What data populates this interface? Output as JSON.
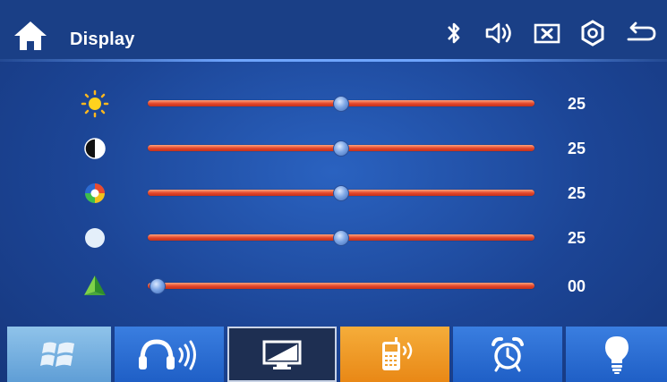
{
  "header": {
    "title": "Display",
    "icons": [
      "bluetooth-icon",
      "volume-icon",
      "mute-icon",
      "settings-icon",
      "back-icon"
    ]
  },
  "sliders": [
    {
      "icon": "brightness-icon",
      "value": "25",
      "level": 0.5
    },
    {
      "icon": "contrast-icon",
      "value": "25",
      "level": 0.5
    },
    {
      "icon": "saturation-icon",
      "value": "25",
      "level": 0.5
    },
    {
      "icon": "hue-icon",
      "value": "25",
      "level": 0.5
    },
    {
      "icon": "sharpness-icon",
      "value": "00",
      "level": 0.0
    }
  ],
  "tabs": [
    "windows-icon",
    "headphones-icon",
    "display-icon",
    "phone-icon",
    "alarm-icon",
    "bulb-icon"
  ],
  "colors": {
    "background": "#1c4596",
    "track": "#e2452a",
    "active_tab": "#1e2f52",
    "phone_tab": "#f09a1e"
  }
}
